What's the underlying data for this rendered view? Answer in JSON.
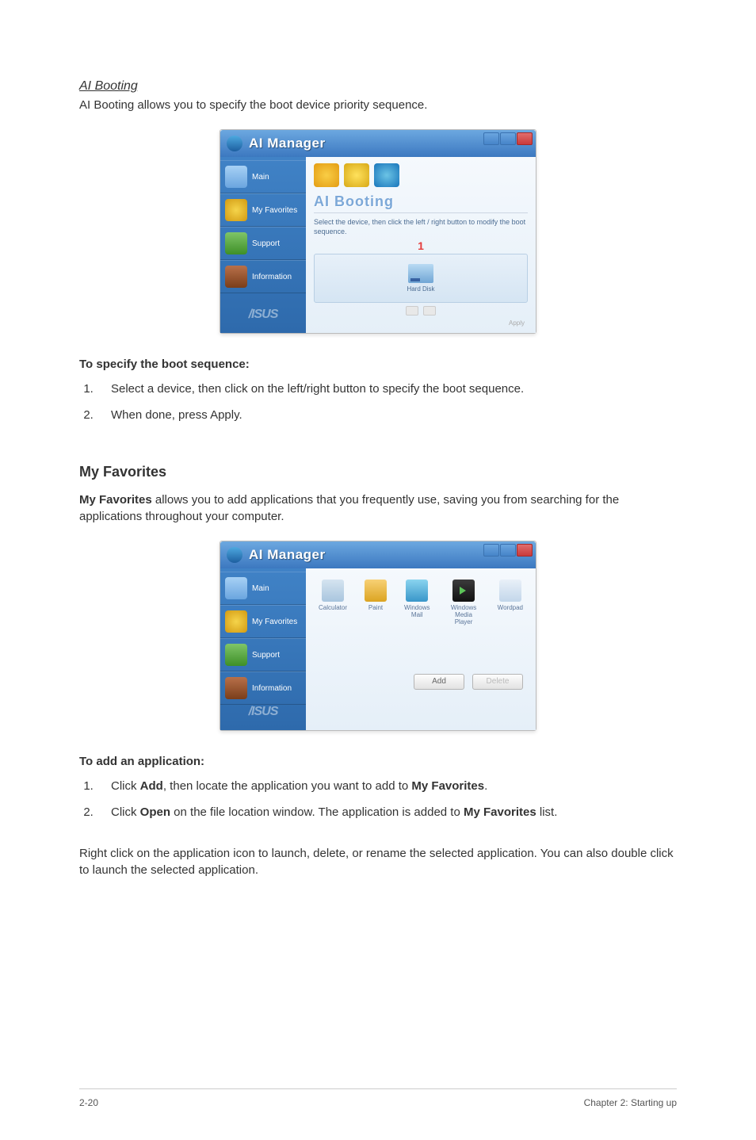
{
  "section1": {
    "heading": "AI Booting",
    "desc": "AI Booting allows you to specify the boot device priority sequence."
  },
  "win1": {
    "title": "AI Manager",
    "sidebar": [
      "Main",
      "My Favorites",
      "Support",
      "Information"
    ],
    "logo": "/ISUS",
    "content_heading": "AI Booting",
    "instruct": "Select the device, then click the left / right button to modify the boot sequence.",
    "anno": "1",
    "drive_label": "Hard Disk",
    "apply": "Apply"
  },
  "spec_head": "To specify the boot sequence:",
  "spec_steps": [
    "Select a device, then click on the left/right button to specify the boot sequence.",
    "When done, press Apply."
  ],
  "section2": {
    "heading": "My Favorites",
    "desc_pre": "My Favorites",
    "desc_rest": " allows you to add applications that you frequently use, saving you from searching for the applications throughout your computer."
  },
  "win2": {
    "title": "AI Manager",
    "sidebar": [
      "Main",
      "My Favorites",
      "Support",
      "Information"
    ],
    "logo": "/ISUS",
    "items": [
      "Calculator",
      "Paint",
      "Windows Mail",
      "Windows Media Player",
      "Wordpad"
    ],
    "btn_add": "Add",
    "btn_delete": "Delete"
  },
  "add_head": "To add an application:",
  "add_steps": [
    {
      "pre": "Click ",
      "b1": "Add",
      "mid": ", then locate the application you want to add to ",
      "b2": "My Favorites",
      "post": "."
    },
    {
      "pre": "Click ",
      "b1": "Open",
      "mid": " on the file location window. The application is added to ",
      "b2": "My Favorites",
      "post": " list."
    }
  ],
  "closing": "Right click on the application icon to launch, delete, or rename the selected application. You can also double click to launch the selected application.",
  "footer": {
    "left": "2-20",
    "right": "Chapter 2: Starting up"
  }
}
